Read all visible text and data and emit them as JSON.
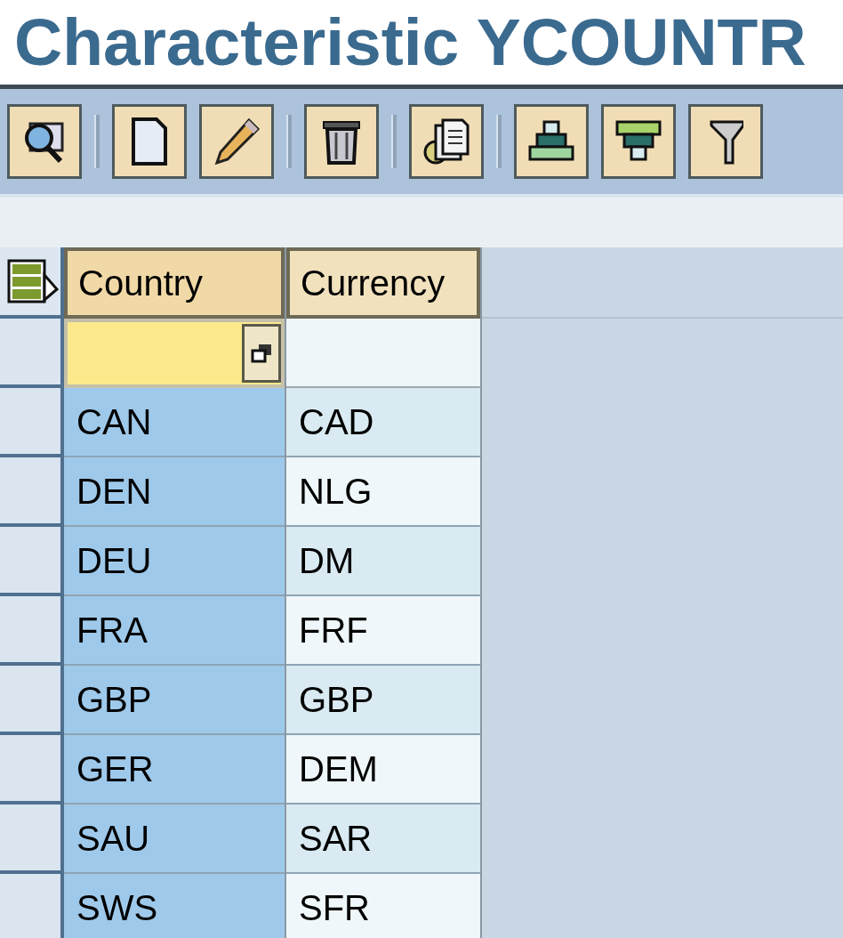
{
  "window": {
    "title": "Characteristic YCOUNTR"
  },
  "toolbar_groups": [
    [
      {
        "kind": "display"
      }
    ],
    [
      {
        "kind": "create"
      },
      {
        "kind": "edit"
      }
    ],
    [
      {
        "kind": "delete"
      }
    ],
    [
      {
        "kind": "copy"
      }
    ],
    [
      {
        "kind": "sort_up"
      },
      {
        "kind": "sort_down"
      },
      {
        "kind": "filter"
      }
    ]
  ],
  "table": {
    "columns": [
      {
        "label": "Country",
        "selected": true
      },
      {
        "label": "Currency",
        "selected": false
      }
    ],
    "rows": [
      [
        "CAN",
        "CAD"
      ],
      [
        "DEN",
        "NLG"
      ],
      [
        "DEU",
        "DM"
      ],
      [
        "FRA",
        "FRF"
      ],
      [
        "GBP",
        "GBP"
      ],
      [
        "GER",
        "DEM"
      ],
      [
        "SAU",
        "SAR"
      ],
      [
        "SWS",
        "SFR"
      ]
    ]
  }
}
